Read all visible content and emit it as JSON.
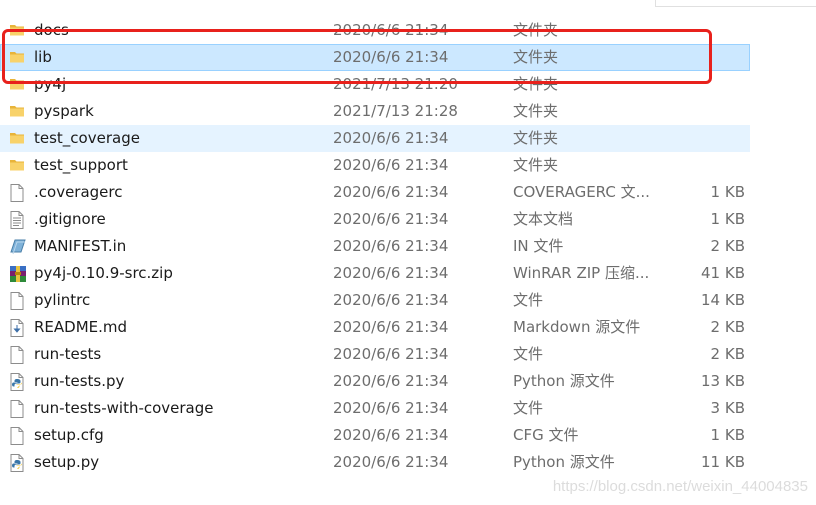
{
  "files": [
    {
      "name": "docs",
      "date": "2020/6/6 21:34",
      "type": "文件夹",
      "size": "",
      "icon": "folder-icon",
      "state": "normal"
    },
    {
      "name": "lib",
      "date": "2020/6/6 21:34",
      "type": "文件夹",
      "size": "",
      "icon": "folder-icon",
      "state": "selected"
    },
    {
      "name": "py4j",
      "date": "2021/7/13 21:20",
      "type": "文件夹",
      "size": "",
      "icon": "folder-icon",
      "state": "normal"
    },
    {
      "name": "pyspark",
      "date": "2021/7/13 21:28",
      "type": "文件夹",
      "size": "",
      "icon": "folder-icon",
      "state": "normal"
    },
    {
      "name": "test_coverage",
      "date": "2020/6/6 21:34",
      "type": "文件夹",
      "size": "",
      "icon": "folder-icon",
      "state": "hover"
    },
    {
      "name": "test_support",
      "date": "2020/6/6 21:34",
      "type": "文件夹",
      "size": "",
      "icon": "folder-icon",
      "state": "normal"
    },
    {
      "name": ".coveragerc",
      "date": "2020/6/6 21:34",
      "type": "COVERAGERC 文...",
      "size": "1 KB",
      "icon": "blank-file-icon",
      "state": "normal"
    },
    {
      "name": ".gitignore",
      "date": "2020/6/6 21:34",
      "type": "文本文档",
      "size": "1 KB",
      "icon": "text-file-icon",
      "state": "normal"
    },
    {
      "name": "MANIFEST.in",
      "date": "2020/6/6 21:34",
      "type": "IN 文件",
      "size": "2 KB",
      "icon": "manifest-file-icon",
      "state": "normal"
    },
    {
      "name": "py4j-0.10.9-src.zip",
      "date": "2020/6/6 21:34",
      "type": "WinRAR ZIP 压缩...",
      "size": "41 KB",
      "icon": "winrar-archive-icon",
      "state": "normal"
    },
    {
      "name": "pylintrc",
      "date": "2020/6/6 21:34",
      "type": "文件",
      "size": "14 KB",
      "icon": "blank-file-icon",
      "state": "normal"
    },
    {
      "name": "README.md",
      "date": "2020/6/6 21:34",
      "type": "Markdown 源文件",
      "size": "2 KB",
      "icon": "markdown-file-icon",
      "state": "normal"
    },
    {
      "name": "run-tests",
      "date": "2020/6/6 21:34",
      "type": "文件",
      "size": "2 KB",
      "icon": "blank-file-icon",
      "state": "normal"
    },
    {
      "name": "run-tests.py",
      "date": "2020/6/6 21:34",
      "type": "Python 源文件",
      "size": "13 KB",
      "icon": "python-file-icon",
      "state": "normal"
    },
    {
      "name": "run-tests-with-coverage",
      "date": "2020/6/6 21:34",
      "type": "文件",
      "size": "3 KB",
      "icon": "blank-file-icon",
      "state": "normal"
    },
    {
      "name": "setup.cfg",
      "date": "2020/6/6 21:34",
      "type": "CFG 文件",
      "size": "1 KB",
      "icon": "blank-file-icon",
      "state": "normal"
    },
    {
      "name": "setup.py",
      "date": "2020/6/6 21:34",
      "type": "Python 源文件",
      "size": "11 KB",
      "icon": "python-file-icon",
      "state": "normal"
    }
  ],
  "watermark": "https://blog.csdn.net/weixin_44004835",
  "colors": {
    "selected_bg": "#cce8ff",
    "hover_bg": "#e5f3ff",
    "highlight_border": "#e8211c",
    "folder": "#f4c542"
  }
}
